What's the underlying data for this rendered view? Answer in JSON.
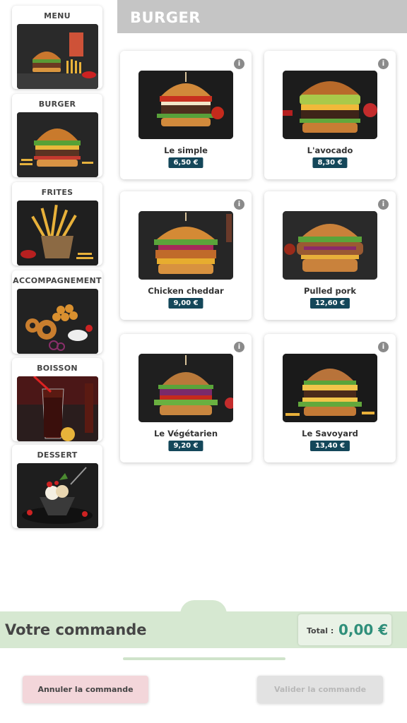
{
  "sidebar": {
    "categories": [
      {
        "label": "MENU",
        "icon": "menu-combo-photo"
      },
      {
        "label": "BURGER",
        "icon": "burger-photo"
      },
      {
        "label": "FRITES",
        "icon": "fries-photo"
      },
      {
        "label": "ACCOMPAGNEMENT",
        "icon": "sides-photo"
      },
      {
        "label": "BOISSON",
        "icon": "drink-photo"
      },
      {
        "label": "DESSERT",
        "icon": "dessert-photo"
      }
    ]
  },
  "header": {
    "title": "BURGER"
  },
  "products": [
    {
      "name": "Le simple",
      "price": "6,50 €",
      "info": "i"
    },
    {
      "name": "L'avocado",
      "price": "8,30 €",
      "info": "i"
    },
    {
      "name": "Chicken cheddar",
      "price": "9,00 €",
      "info": "i"
    },
    {
      "name": "Pulled pork",
      "price": "12,60 €",
      "info": "i"
    },
    {
      "name": "Le Végétarien",
      "price": "9,20 €",
      "info": "i"
    },
    {
      "name": "Le Savoyard",
      "price": "13,40 €",
      "info": "i"
    }
  ],
  "order": {
    "title": "Votre commande",
    "total_label": "Total :",
    "total_value": "0,00 €"
  },
  "actions": {
    "cancel_label": "Annuler la commande",
    "validate_label": "Valider la commande"
  },
  "colors": {
    "header_bg": "#c5c5c5",
    "price_badge": "#14475a",
    "order_bar": "#d6e8d1",
    "total_text": "#2f8f7a",
    "cancel_bg": "#f3d6da",
    "validate_bg": "#e2e2e2"
  }
}
